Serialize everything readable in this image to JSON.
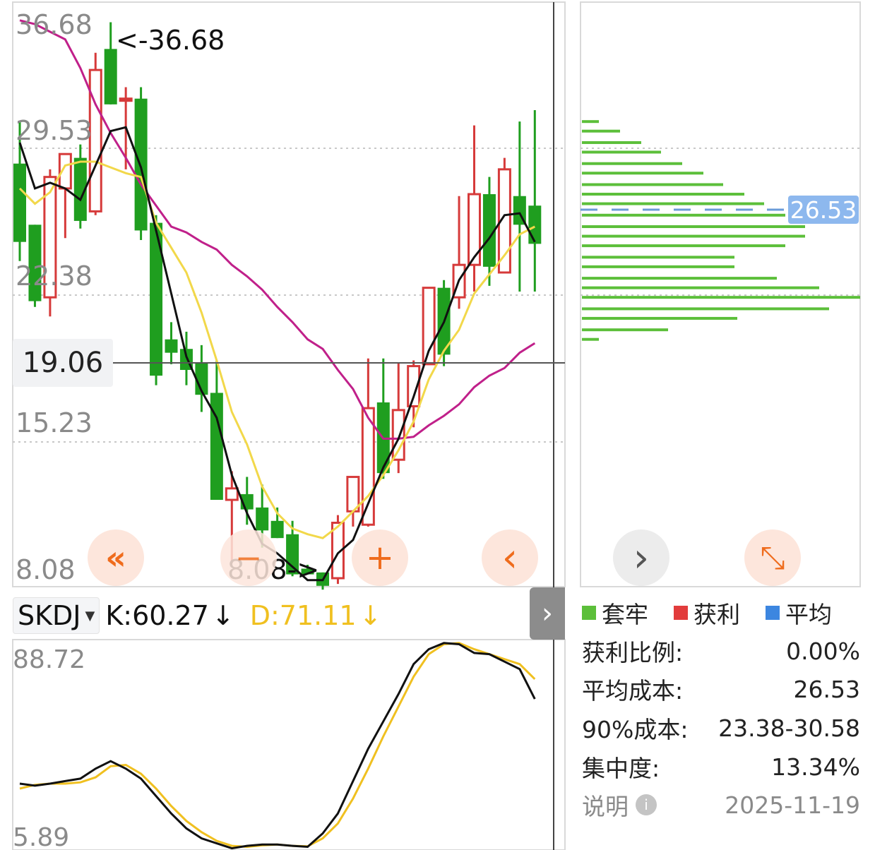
{
  "main_chart": {
    "y_labels": [
      "36.68",
      "29.53",
      "22.38",
      "15.23",
      "8.08"
    ],
    "max_marker": "<-36.68",
    "min_marker": "8.08->",
    "current_price_label": "19.06",
    "current_price": 19.06
  },
  "indicator": {
    "name": "SKDJ",
    "k_label": "K:60.27",
    "k_arrow": "↓",
    "d_label": "D:71.11",
    "d_arrow": "↓",
    "y_max": "88.72",
    "y_min": "5.89",
    "k_color": "#111111",
    "d_color": "#f0c020"
  },
  "colors": {
    "up": "#d63a3a",
    "down": "#1f9e1f",
    "ma_black": "#111111",
    "ma_yellow": "#f2d84a",
    "ma_magenta": "#c0208a",
    "chip_green": "#5cbf3a",
    "chip_avg": "#6a9bd8",
    "orange": "#ef6c1d"
  },
  "chip_panel": {
    "avg_cost_tag": "26.53",
    "legend": [
      {
        "label": "套牢",
        "color": "#5cbf3a"
      },
      {
        "label": "获利",
        "color": "#e23c3c"
      },
      {
        "label": "平均",
        "color": "#3c86e0"
      }
    ],
    "stats": [
      {
        "label": "获利比例:",
        "value": "0.00%"
      },
      {
        "label": "平均成本:",
        "value": "26.53"
      },
      {
        "label": "90%成本:",
        "value": "23.38-30.58"
      },
      {
        "label": "集中度:",
        "value": "13.34%"
      }
    ],
    "note_label": "说明",
    "date": "2025-11-19"
  },
  "controls": {
    "rewind": "«",
    "zoom_out": "−",
    "zoom_in": "+",
    "prev": "‹",
    "next": "›",
    "expand": "⤡",
    "collapse": "›"
  },
  "chart_data": {
    "type": "candlestick",
    "ylim": [
      8.08,
      36.68
    ],
    "candles": [
      {
        "o": 29.3,
        "h": 31.5,
        "l": 24.2,
        "c": 25.2
      },
      {
        "o": 26.1,
        "h": 26.1,
        "l": 21.8,
        "c": 22.1
      },
      {
        "o": 22.3,
        "h": 29.0,
        "l": 21.3,
        "c": 28.6
      },
      {
        "o": 28.0,
        "h": 29.7,
        "l": 25.4,
        "c": 29.8
      },
      {
        "o": 29.6,
        "h": 30.3,
        "l": 25.9,
        "c": 26.3
      },
      {
        "o": 26.8,
        "h": 35.1,
        "l": 26.6,
        "c": 34.2
      },
      {
        "o": 35.3,
        "h": 36.7,
        "l": 32.8,
        "c": 32.4
      },
      {
        "o": 32.7,
        "h": 33.3,
        "l": 29.0,
        "c": 32.7
      },
      {
        "o": 32.7,
        "h": 33.3,
        "l": 25.3,
        "c": 25.8
      },
      {
        "o": 26.2,
        "h": 26.6,
        "l": 17.7,
        "c": 18.2
      },
      {
        "o": 20.1,
        "h": 21.0,
        "l": 18.8,
        "c": 19.4
      },
      {
        "o": 19.6,
        "h": 20.5,
        "l": 17.7,
        "c": 18.5
      },
      {
        "o": 18.9,
        "h": 19.8,
        "l": 16.3,
        "c": 17.2
      },
      {
        "o": 17.3,
        "h": 19.0,
        "l": 11.8,
        "c": 11.7
      },
      {
        "o": 11.7,
        "h": 13.2,
        "l": 8.4,
        "c": 12.3
      },
      {
        "o": 12.0,
        "h": 12.9,
        "l": 10.4,
        "c": 11.2
      },
      {
        "o": 11.3,
        "h": 12.5,
        "l": 9.2,
        "c": 10.1
      },
      {
        "o": 10.6,
        "h": 11.3,
        "l": 9.7,
        "c": 9.7
      },
      {
        "o": 9.9,
        "h": 10.6,
        "l": 7.7,
        "c": 7.8
      },
      {
        "o": 8.1,
        "h": 8.3,
        "l": 7.8,
        "c": 7.8
      },
      {
        "o": 7.9,
        "h": 7.8,
        "l": 7.0,
        "c": 7.2
      },
      {
        "o": 7.6,
        "h": 10.9,
        "l": 7.3,
        "c": 10.5
      },
      {
        "o": 11.1,
        "h": 12.3,
        "l": 10.3,
        "c": 12.9
      },
      {
        "o": 10.4,
        "h": 19.1,
        "l": 10.3,
        "c": 16.5
      },
      {
        "o": 16.8,
        "h": 19.1,
        "l": 12.8,
        "c": 13.1
      },
      {
        "o": 13.8,
        "h": 18.9,
        "l": 13.1,
        "c": 16.4
      },
      {
        "o": 16.6,
        "h": 19.0,
        "l": 15.5,
        "c": 18.7
      },
      {
        "o": 18.8,
        "h": 22.5,
        "l": 18.8,
        "c": 22.8
      },
      {
        "o": 22.8,
        "h": 23.2,
        "l": 18.7,
        "c": 19.3
      },
      {
        "o": 22.3,
        "h": 27.6,
        "l": 21.7,
        "c": 24.0
      },
      {
        "o": 24.0,
        "h": 31.3,
        "l": 22.6,
        "c": 27.7
      },
      {
        "o": 27.7,
        "h": 28.6,
        "l": 22.9,
        "c": 23.9
      },
      {
        "o": 23.6,
        "h": 29.6,
        "l": 23.6,
        "c": 29.0
      },
      {
        "o": 27.6,
        "h": 31.5,
        "l": 22.6,
        "c": 26.1
      },
      {
        "o": 27.1,
        "h": 32.1,
        "l": 22.6,
        "c": 25.1
      }
    ],
    "ma_black": [
      30.4,
      28.0,
      28.3,
      28.0,
      27.4,
      29.2,
      31.0,
      31.2,
      29.1,
      25.8,
      22.5,
      19.2,
      17.4,
      16.0,
      13.0,
      11.0,
      9.4,
      8.9,
      8.2,
      7.5,
      7.5,
      8.9,
      9.6,
      11.5,
      13.4,
      14.9,
      17.1,
      19.5,
      21.0,
      23.2,
      24.4,
      25.4,
      26.6,
      26.7,
      25.2
    ],
    "ma_yellow": [
      28.0,
      27.2,
      27.8,
      29.2,
      29.4,
      29.4,
      29.1,
      28.8,
      28.6,
      26.2,
      24.9,
      23.6,
      21.5,
      19.0,
      16.3,
      14.6,
      12.4,
      11.0,
      10.2,
      9.9,
      9.7,
      10.3,
      11.1,
      11.9,
      13.0,
      14.3,
      15.8,
      18.0,
      19.5,
      20.6,
      22.5,
      23.5,
      24.5,
      25.6,
      26.0
    ],
    "ma_magenta": [
      36.8,
      36.6,
      36.2,
      35.8,
      34.3,
      32.4,
      30.9,
      29.6,
      28.2,
      27.1,
      26.0,
      25.7,
      25.2,
      24.8,
      24.0,
      23.4,
      22.7,
      21.8,
      21.0,
      20.1,
      19.6,
      18.5,
      17.5,
      16.0,
      14.9,
      14.9,
      15.0,
      15.6,
      16.1,
      16.7,
      17.6,
      18.2,
      18.6,
      19.4,
      19.9
    ],
    "skdj_k": [
      32.0,
      31.2,
      32.0,
      33.0,
      34.0,
      38.0,
      41.0,
      38.0,
      34.0,
      27.0,
      20.0,
      14.0,
      10.0,
      8.0,
      6.0,
      7.0,
      7.5,
      7.5,
      7.0,
      6.6,
      12.0,
      20.0,
      33.0,
      46.0,
      57.0,
      68.0,
      80.0,
      86.0,
      88.5,
      88.0,
      84.5,
      84.0,
      81.0,
      78.0,
      66.0
    ],
    "skdj_d": [
      30.0,
      31.5,
      32.0,
      32.0,
      32.5,
      34.5,
      39.0,
      39.5,
      36.0,
      30.0,
      23.0,
      17.0,
      12.5,
      9.0,
      7.0,
      6.6,
      7.2,
      7.5,
      7.0,
      6.8,
      10.0,
      16.0,
      26.0,
      38.0,
      51.0,
      63.0,
      75.0,
      84.0,
      88.0,
      88.5,
      86.0,
      84.0,
      82.0,
      80.0,
      74.0
    ],
    "skdj_ylim": [
      5.89,
      88.72
    ],
    "chip_bars": [
      {
        "price": 31.5,
        "len": 24
      },
      {
        "price": 31.0,
        "len": 54
      },
      {
        "price": 30.4,
        "len": 84
      },
      {
        "price": 29.9,
        "len": 112
      },
      {
        "price": 29.3,
        "len": 142
      },
      {
        "price": 28.8,
        "len": 172
      },
      {
        "price": 28.2,
        "len": 200
      },
      {
        "price": 27.7,
        "len": 230
      },
      {
        "price": 27.2,
        "len": 258
      },
      {
        "price": 26.6,
        "len": 288
      },
      {
        "price": 26.0,
        "len": 316
      },
      {
        "price": 25.5,
        "len": 316
      },
      {
        "price": 25.0,
        "len": 288
      },
      {
        "price": 24.4,
        "len": 216
      },
      {
        "price": 23.9,
        "len": 216
      },
      {
        "price": 23.3,
        "len": 276
      },
      {
        "price": 22.8,
        "len": 336
      },
      {
        "price": 22.3,
        "len": 394
      },
      {
        "price": 21.7,
        "len": 350
      },
      {
        "price": 21.2,
        "len": 220
      },
      {
        "price": 20.6,
        "len": 122
      },
      {
        "price": 20.1,
        "len": 24
      }
    ]
  }
}
